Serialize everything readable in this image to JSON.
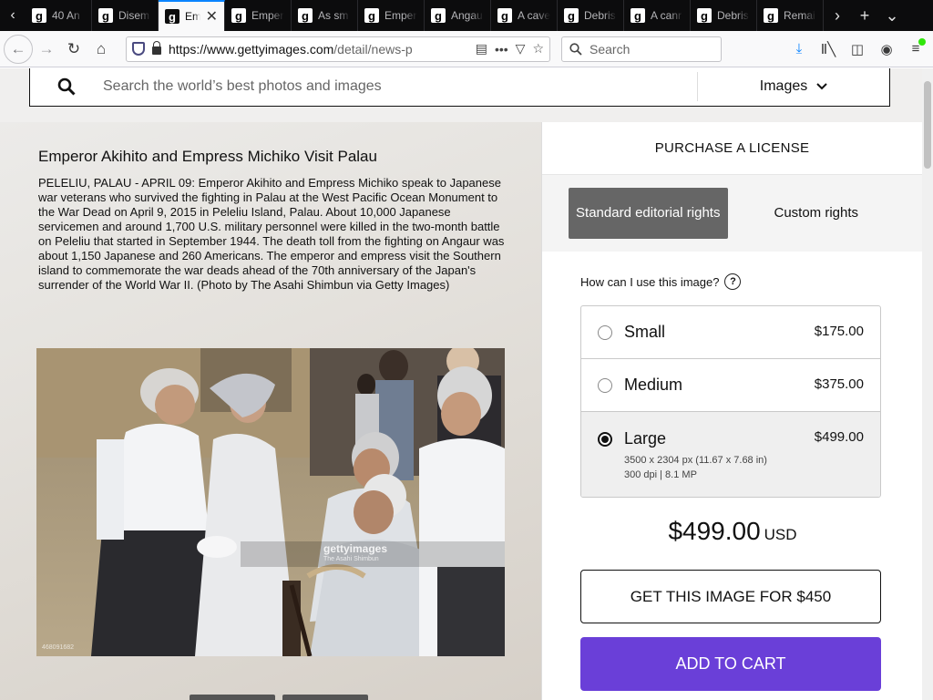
{
  "browser": {
    "tabs": [
      {
        "title": "40 An",
        "active": false
      },
      {
        "title": "Disem",
        "active": false
      },
      {
        "title": "Em",
        "active": true
      },
      {
        "title": "Emper",
        "active": false
      },
      {
        "title": "As sm",
        "active": false
      },
      {
        "title": "Emper",
        "active": false
      },
      {
        "title": "Angau",
        "active": false
      },
      {
        "title": "A cave",
        "active": false
      },
      {
        "title": "Debris",
        "active": false
      },
      {
        "title": "A canr",
        "active": false
      },
      {
        "title": "Debris",
        "active": false
      },
      {
        "title": "Remai",
        "active": false
      }
    ],
    "favicon_letter": "g",
    "url_host": "https://www.gettyimages.com",
    "url_path": "/detail/news-p",
    "search_placeholder": "Search",
    "colors": {
      "tabbar": "#0c0c0d",
      "active_tab_accent": "#0a84ff"
    }
  },
  "site_search": {
    "placeholder": "Search the world’s best photos and images",
    "filter_label": "Images"
  },
  "caption": {
    "title": "Emperor Akihito and Empress Michiko Visit Palau",
    "body": "PELELIU, PALAU - APRIL 09: Emperor Akihito and Empress Michiko speak to Japanese war veterans who survived the fighting in Palau at the West Pacific Ocean Monument to the War Dead on April 9, 2015 in Peleliu Island, Palau. About 10,000 Japanese servicemen and around 1,700 U.S. military personnel were killed in the two-month battle on Peleliu that started in September 1944. The death toll from the fighting on Angaur was about 1,150 Japanese and 260 Americans. The emperor and empress visit the Southern island to commemorate the war deads ahead of the 70th anniversary of the Japan's surrender of the World War II. (Photo by The Asahi Shimbun via Getty Images)"
  },
  "photo": {
    "watermark": "gettyimages",
    "watermark_credit": "The Asahi Shimbun",
    "photo_id": "468091682"
  },
  "purchase": {
    "heading": "PURCHASE A LICENSE",
    "rights": [
      {
        "label": "Standard editorial rights",
        "selected": true
      },
      {
        "label": "Custom rights",
        "selected": false
      }
    ],
    "usage_question": "How can I use this image?",
    "sizes": [
      {
        "name": "Small",
        "price": "$175.00"
      },
      {
        "name": "Medium",
        "price": "$375.00"
      },
      {
        "name": "Large",
        "price": "$499.00",
        "details_line1": "3500 x 2304 px (11.67 x 7.68 in)",
        "details_line2": "300 dpi | 8.1 MP"
      }
    ],
    "selected_size": "Large",
    "total_amount": "$499.00",
    "total_currency": "USD",
    "get_image_label": "GET THIS IMAGE FOR $450",
    "add_to_cart_label": "ADD TO CART",
    "colors": {
      "cart_button": "#6a3fd8",
      "selected_rights": "#666666"
    }
  }
}
